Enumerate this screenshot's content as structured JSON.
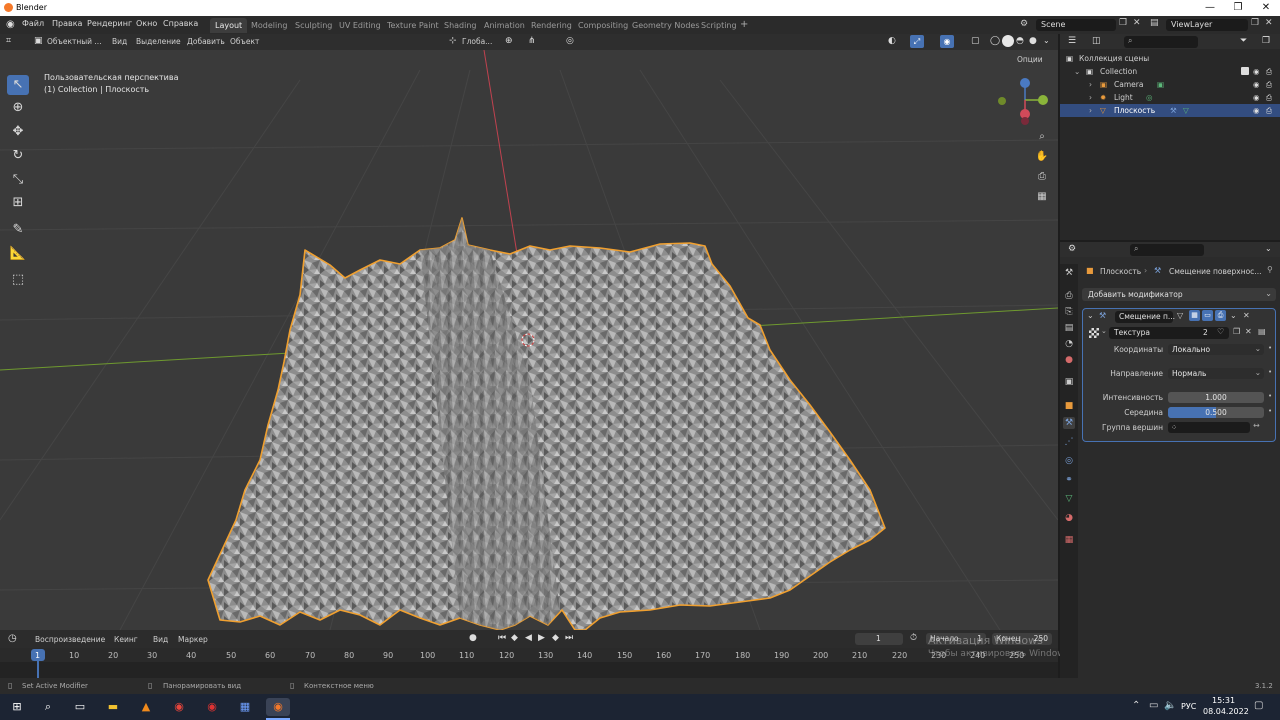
{
  "window": {
    "title": "Blender"
  },
  "menu": [
    "Файл",
    "Правка",
    "Рендеринг",
    "Окно",
    "Справка"
  ],
  "workspaces": [
    "Layout",
    "Modeling",
    "Sculpting",
    "UV Editing",
    "Texture Paint",
    "Shading",
    "Animation",
    "Rendering",
    "Compositing",
    "Geometry Nodes",
    "Scripting"
  ],
  "workspace_active": "Layout",
  "scene": "Scene",
  "view_layer": "ViewLayer",
  "viewport_header": {
    "mode": "Объектный ...",
    "items": [
      "Вид",
      "Выделение",
      "Добавить",
      "Объект"
    ],
    "orientation": "Глоба...",
    "options": "Опции"
  },
  "viewport": {
    "perspective": "Пользовательская перспектива",
    "collection_info": "(1) Collection | Плоскость"
  },
  "timeline": {
    "header_items": [
      "Воспроизведение",
      "Кеинг",
      "Вид",
      "Маркер"
    ],
    "current_frame": "1",
    "start_label": "Начало",
    "start": "1",
    "end_label": "Конец",
    "end": "250",
    "ticks": [
      "1",
      "10",
      "20",
      "30",
      "40",
      "50",
      "60",
      "70",
      "80",
      "90",
      "100",
      "110",
      "120",
      "130",
      "140",
      "150",
      "160",
      "170",
      "180",
      "190",
      "200",
      "210",
      "220",
      "230",
      "240",
      "250"
    ]
  },
  "activation_watermark": {
    "line1": "Активация Windows",
    "line2": "Чтобы активировать Windows, перейдите в раздел \"Параметры\"."
  },
  "statusbar": {
    "items": [
      "Set Active Modifier",
      "Панорамировать вид",
      "Контекстное меню"
    ],
    "version": "3.1.2"
  },
  "outliner": {
    "root": "Коллекция сцены",
    "collection": "Collection",
    "items": [
      {
        "name": "Camera",
        "selected": false
      },
      {
        "name": "Light",
        "selected": false
      },
      {
        "name": "Плоскость",
        "selected": true
      }
    ]
  },
  "properties": {
    "breadcrumb_object": "Плоскость",
    "breadcrumb_modifier": "Смещение поверхнос...",
    "add_modifier": "Добавить модификатор",
    "modifier_name": "Смещение п...",
    "texture_label": "Текстура",
    "texture_users": "2",
    "fields": {
      "coords_label": "Координаты",
      "coords_value": "Локально",
      "direction_label": "Направление",
      "direction_value": "Нормаль",
      "strength_label": "Интенсивность",
      "strength_value": "1.000",
      "midlevel_label": "Середина",
      "midlevel_value": "0.500",
      "vgroup_label": "Группа вершин"
    },
    "midlevel_fraction": 0.5
  },
  "taskbar": {
    "language": "РУС",
    "time": "15:31",
    "date": "08.04.2022"
  },
  "colors": {
    "accent": "#4772b3",
    "selection_outline": "#f0a030",
    "x_axis": "#c0424f",
    "y_axis": "#6f9a2f"
  }
}
